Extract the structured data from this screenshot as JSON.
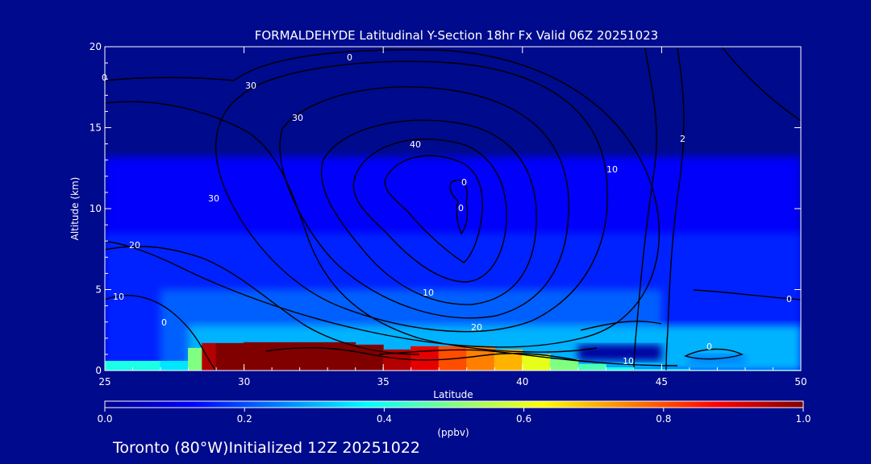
{
  "chart_data": {
    "type": "heatmap",
    "title": "FORMALDEHYDE Latitudinal Y-Section 18hr  Fx Valid 06Z 20251023",
    "xlabel": "Latitude",
    "ylabel": "Altitude (km)",
    "xlim": [
      25,
      50
    ],
    "ylim": [
      0,
      20
    ],
    "x_ticks": [
      "25",
      "30",
      "35",
      "40",
      "45",
      "50"
    ],
    "y_ticks": [
      "0",
      "5",
      "10",
      "15",
      "20"
    ],
    "grid": false,
    "background_color": "#000a8c",
    "colorbar": {
      "label": "(ppbv)",
      "min": 0.0,
      "max": 1.0,
      "ticks": [
        "0.0",
        "0.2",
        "0.4",
        "0.6",
        "0.8",
        "1.0"
      ],
      "colormap": [
        "#00008f",
        "#0000ff",
        "#0080ff",
        "#00ffff",
        "#80ff80",
        "#ffff00",
        "#ff8000",
        "#ff0000",
        "#800000"
      ]
    },
    "contour_labels": [
      "40",
      "30",
      "30",
      "30",
      "20",
      "10",
      "0",
      "0",
      "0",
      "10",
      "20",
      "10",
      "0",
      "0",
      "10",
      "2",
      "0",
      "0"
    ],
    "x_samples": [
      25,
      26,
      27,
      28,
      28.5,
      29,
      30,
      31,
      32,
      33,
      34,
      35,
      36,
      37,
      38,
      39,
      40,
      41,
      42,
      43,
      44,
      45,
      46,
      47,
      48,
      49,
      50
    ],
    "series": [
      {
        "values_upper_km": [
          0.6,
          0.6,
          0.5,
          0.6,
          1.4,
          1.7,
          1.7,
          1.75,
          1.75,
          1.75,
          1.6,
          1.2,
          1.3,
          1.5,
          1.5,
          1.3,
          1.0,
          0.7,
          0.4,
          0.2,
          0.1,
          0.1,
          0.05,
          0.05,
          0.05,
          0.05,
          0.05
        ],
        "values_ppbv": [
          0.4,
          0.4,
          0.35,
          0.5,
          0.95,
          1.0,
          1.0,
          1.0,
          1.0,
          1.0,
          1.0,
          0.95,
          0.9,
          0.8,
          0.75,
          0.7,
          0.6,
          0.5,
          0.45,
          0.4,
          0.35,
          0.35,
          0.35,
          0.35,
          0.35,
          0.35,
          0.35
        ]
      }
    ],
    "regions_ppbv": [
      {
        "lat": [
          25,
          50
        ],
        "alt": [
          0,
          13.2
        ],
        "value": 0.12
      },
      {
        "lat": [
          25,
          50
        ],
        "alt": [
          0,
          8.5
        ],
        "value": 0.16
      },
      {
        "lat": [
          27,
          45
        ],
        "alt": [
          0,
          5.0
        ],
        "value": 0.22
      },
      {
        "lat": [
          28,
          50
        ],
        "alt": [
          0,
          2.8
        ],
        "value": 0.3
      },
      {
        "lat": [
          42,
          45
        ],
        "alt": [
          0.6,
          1.6
        ],
        "value": 0.02
      },
      {
        "lat": [
          46,
          48
        ],
        "alt": [
          0.4,
          1.0
        ],
        "value": 0.25
      }
    ],
    "footer_text": "Toronto (80°W)Initialized 12Z 20251022"
  }
}
